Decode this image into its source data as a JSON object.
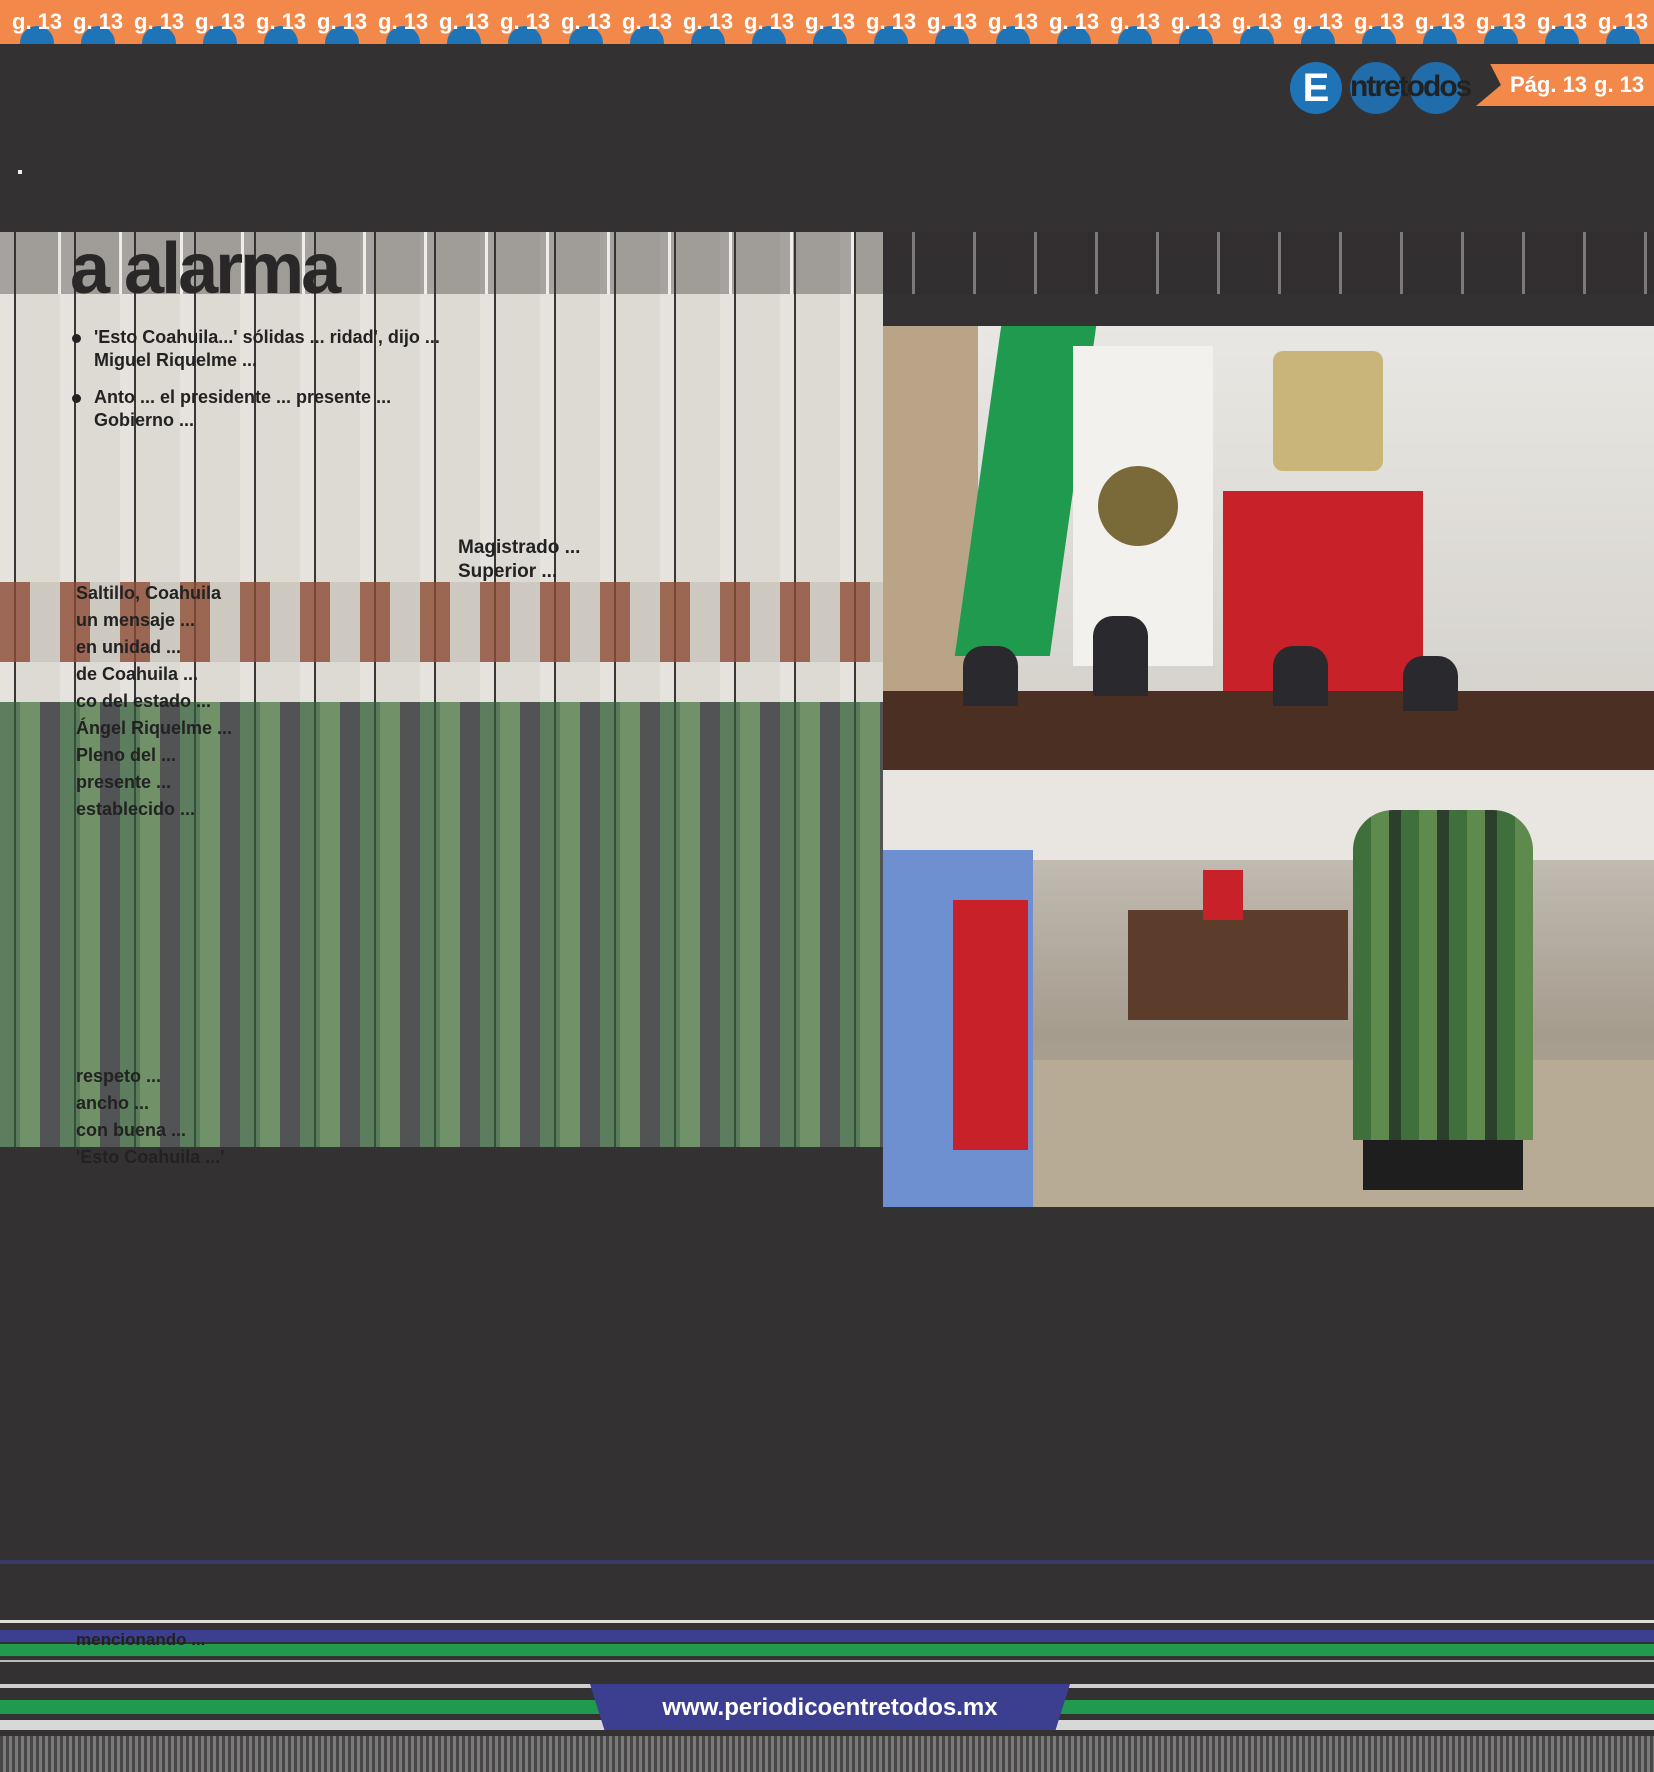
{
  "page_tab": {
    "label": "Pág. 13",
    "label_repeat": "g. 13"
  },
  "top_strip": {
    "repeat_label": "g. 13"
  },
  "masthead": {
    "logo_letter": "E",
    "name": "ntretodos"
  },
  "headline": {
    "text": "a alarma"
  },
  "bullets": [
    "'Esto Coahuila...' sólidas ... ridad', dijo ... Miguel Riquelme ...",
    "Anto ... el presidente ... presente ... Gobierno ..."
  ],
  "byline2": [
    "Magistrado ...",
    "Superior ..."
  ],
  "dateline": "Saltillo, Coahuila",
  "body_paragraphs": [
    "un mensaje ...",
    "en unidad ...",
    "de Coahuila ...",
    "co del estado ...",
    "Ángel Riquelme ...",
    "Pleno del ...",
    "presente ...",
    "establecido ...",
    "respeto ...",
    "ancho ...",
    "con buena ...",
    "'Esto Coahuila ...'"
  ],
  "footer": {
    "url": "www.periodicoentretodos.mx",
    "footer_text": "mencionando ..."
  },
  "colors": {
    "accent_orange": "#f2884a",
    "logo_blue": "#1f74b8",
    "banner_navy": "#3c3f8f",
    "stripe_green": "#1f9a4e"
  }
}
